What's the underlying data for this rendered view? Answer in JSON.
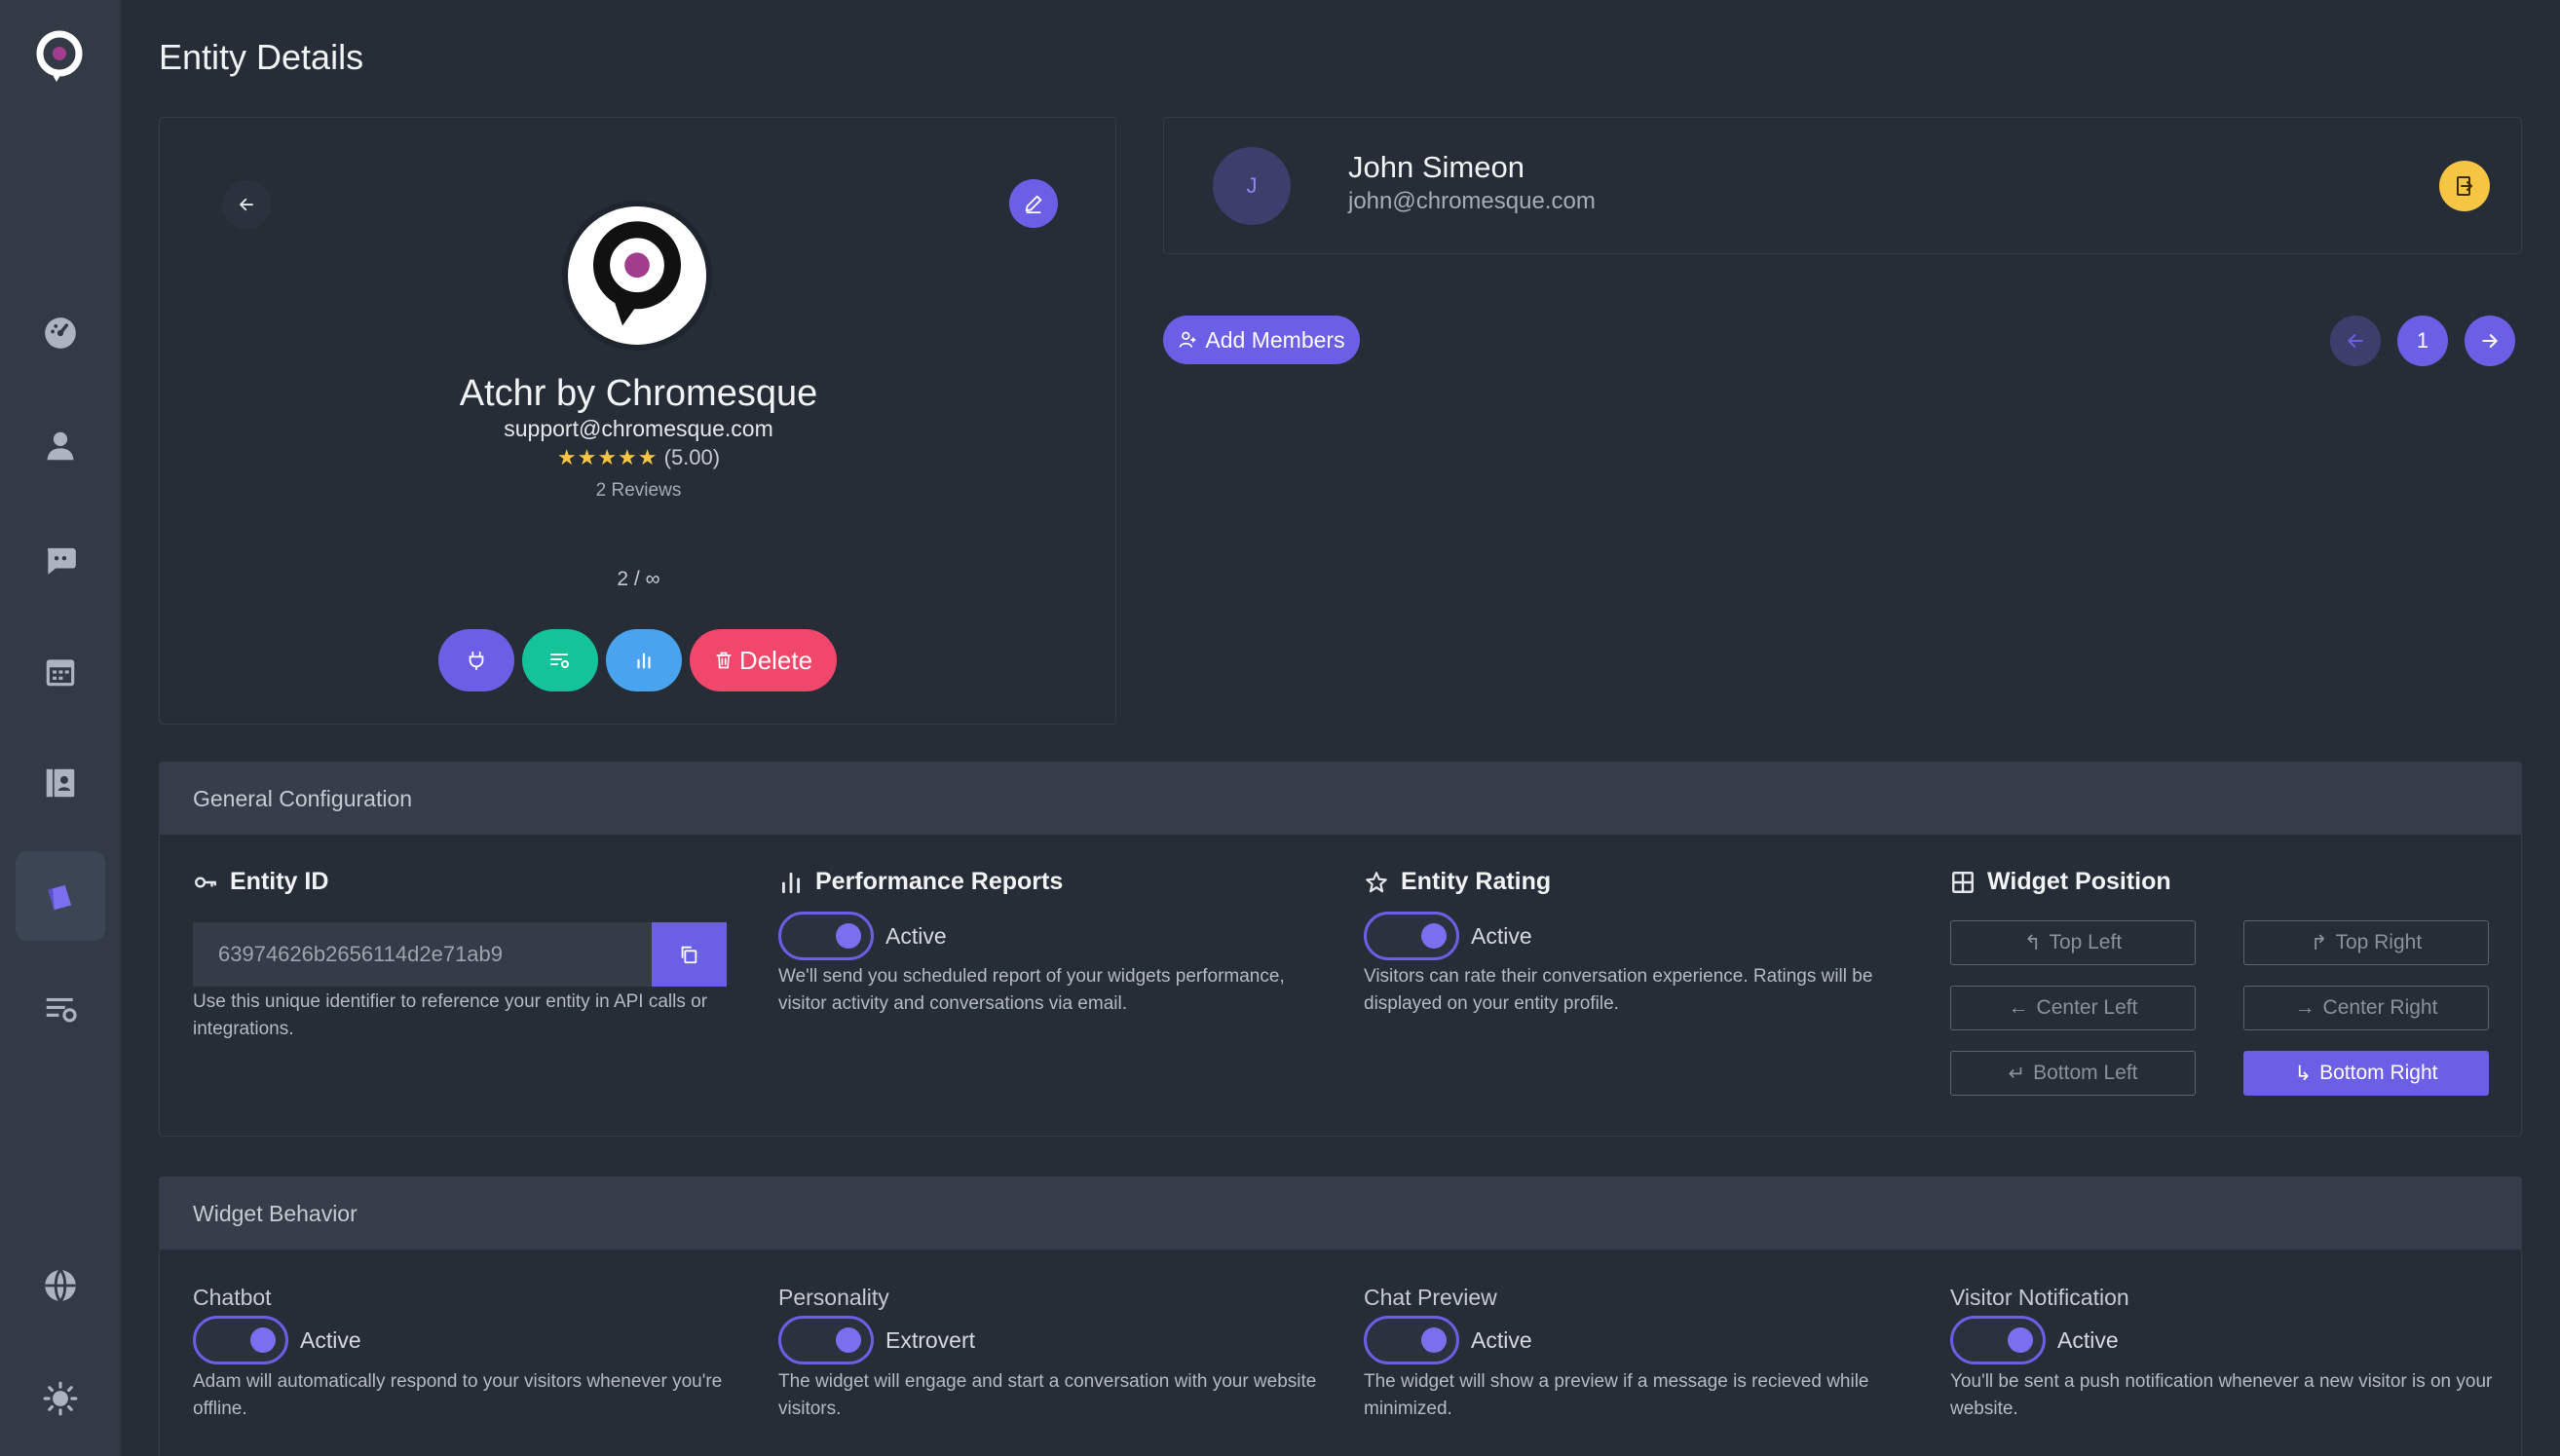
{
  "app": {
    "page_title": "Entity Details",
    "brand_color": "#6b5fe6"
  },
  "sidebar": {
    "items": [
      {
        "icon": "dashboard-icon"
      },
      {
        "icon": "user-icon"
      },
      {
        "icon": "chat-icon"
      },
      {
        "icon": "calendar-icon"
      },
      {
        "icon": "contacts-icon"
      },
      {
        "icon": "entity-icon",
        "active": true
      },
      {
        "icon": "settings-list-icon"
      },
      {
        "icon": "globe-icon"
      },
      {
        "icon": "theme-icon"
      }
    ]
  },
  "entity": {
    "name": "Atchr by Chromesque",
    "email": "support@chromesque.com",
    "stars": "★★★★★",
    "rating": "(5.00)",
    "reviews": "2 Reviews",
    "counter": "2 / ∞",
    "delete_label": "Delete"
  },
  "member": {
    "initial": "J",
    "name": "John Simeon",
    "email": "john@chromesque.com",
    "add_label": "Add Members",
    "page": "1"
  },
  "general": {
    "title": "General Configuration",
    "entity_id": {
      "title": "Entity ID",
      "value": "63974626b2656114d2e71ab9",
      "desc": "Use this unique identifier to reference your entity in API calls or integrations."
    },
    "performance": {
      "title": "Performance Reports",
      "state": "Active",
      "desc": "We'll send you scheduled report of your widgets performance, visitor activity and conversations via email."
    },
    "rating": {
      "title": "Entity Rating",
      "state": "Active",
      "desc": "Visitors can rate their conversation experience. Ratings will be displayed on your entity profile."
    },
    "widget_position": {
      "title": "Widget Position",
      "options": {
        "top_left": "Top Left",
        "top_right": "Top Right",
        "center_left": "Center Left",
        "center_right": "Center Right",
        "bottom_left": "Bottom Left",
        "bottom_right": "Bottom Right"
      },
      "selected": "Bottom Right"
    }
  },
  "behavior": {
    "title": "Widget Behavior",
    "chatbot": {
      "label": "Chatbot",
      "state": "Active",
      "desc": "Adam will automatically respond to your visitors whenever you're offline."
    },
    "personality": {
      "label": "Personality",
      "state": "Extrovert",
      "desc": "The widget will engage and start a conversation with your website visitors."
    },
    "chat_preview": {
      "label": "Chat Preview",
      "state": "Active",
      "desc": "The widget will show a preview if a message is recieved while minimized."
    },
    "visitor_notification": {
      "label": "Visitor Notification",
      "state": "Active",
      "desc": "You'll be sent a push notification whenever a new visitor is on your website."
    }
  }
}
